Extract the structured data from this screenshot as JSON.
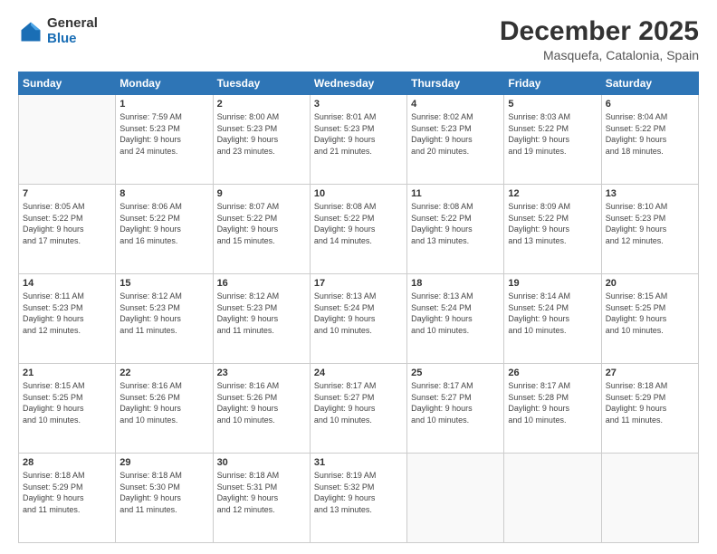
{
  "header": {
    "logo_general": "General",
    "logo_blue": "Blue",
    "month_title": "December 2025",
    "location": "Masquefa, Catalonia, Spain"
  },
  "days_of_week": [
    "Sunday",
    "Monday",
    "Tuesday",
    "Wednesday",
    "Thursday",
    "Friday",
    "Saturday"
  ],
  "weeks": [
    [
      {
        "num": "",
        "info": ""
      },
      {
        "num": "1",
        "info": "Sunrise: 7:59 AM\nSunset: 5:23 PM\nDaylight: 9 hours\nand 24 minutes."
      },
      {
        "num": "2",
        "info": "Sunrise: 8:00 AM\nSunset: 5:23 PM\nDaylight: 9 hours\nand 23 minutes."
      },
      {
        "num": "3",
        "info": "Sunrise: 8:01 AM\nSunset: 5:23 PM\nDaylight: 9 hours\nand 21 minutes."
      },
      {
        "num": "4",
        "info": "Sunrise: 8:02 AM\nSunset: 5:23 PM\nDaylight: 9 hours\nand 20 minutes."
      },
      {
        "num": "5",
        "info": "Sunrise: 8:03 AM\nSunset: 5:22 PM\nDaylight: 9 hours\nand 19 minutes."
      },
      {
        "num": "6",
        "info": "Sunrise: 8:04 AM\nSunset: 5:22 PM\nDaylight: 9 hours\nand 18 minutes."
      }
    ],
    [
      {
        "num": "7",
        "info": "Sunrise: 8:05 AM\nSunset: 5:22 PM\nDaylight: 9 hours\nand 17 minutes."
      },
      {
        "num": "8",
        "info": "Sunrise: 8:06 AM\nSunset: 5:22 PM\nDaylight: 9 hours\nand 16 minutes."
      },
      {
        "num": "9",
        "info": "Sunrise: 8:07 AM\nSunset: 5:22 PM\nDaylight: 9 hours\nand 15 minutes."
      },
      {
        "num": "10",
        "info": "Sunrise: 8:08 AM\nSunset: 5:22 PM\nDaylight: 9 hours\nand 14 minutes."
      },
      {
        "num": "11",
        "info": "Sunrise: 8:08 AM\nSunset: 5:22 PM\nDaylight: 9 hours\nand 13 minutes."
      },
      {
        "num": "12",
        "info": "Sunrise: 8:09 AM\nSunset: 5:22 PM\nDaylight: 9 hours\nand 13 minutes."
      },
      {
        "num": "13",
        "info": "Sunrise: 8:10 AM\nSunset: 5:23 PM\nDaylight: 9 hours\nand 12 minutes."
      }
    ],
    [
      {
        "num": "14",
        "info": "Sunrise: 8:11 AM\nSunset: 5:23 PM\nDaylight: 9 hours\nand 12 minutes."
      },
      {
        "num": "15",
        "info": "Sunrise: 8:12 AM\nSunset: 5:23 PM\nDaylight: 9 hours\nand 11 minutes."
      },
      {
        "num": "16",
        "info": "Sunrise: 8:12 AM\nSunset: 5:23 PM\nDaylight: 9 hours\nand 11 minutes."
      },
      {
        "num": "17",
        "info": "Sunrise: 8:13 AM\nSunset: 5:24 PM\nDaylight: 9 hours\nand 10 minutes."
      },
      {
        "num": "18",
        "info": "Sunrise: 8:13 AM\nSunset: 5:24 PM\nDaylight: 9 hours\nand 10 minutes."
      },
      {
        "num": "19",
        "info": "Sunrise: 8:14 AM\nSunset: 5:24 PM\nDaylight: 9 hours\nand 10 minutes."
      },
      {
        "num": "20",
        "info": "Sunrise: 8:15 AM\nSunset: 5:25 PM\nDaylight: 9 hours\nand 10 minutes."
      }
    ],
    [
      {
        "num": "21",
        "info": "Sunrise: 8:15 AM\nSunset: 5:25 PM\nDaylight: 9 hours\nand 10 minutes."
      },
      {
        "num": "22",
        "info": "Sunrise: 8:16 AM\nSunset: 5:26 PM\nDaylight: 9 hours\nand 10 minutes."
      },
      {
        "num": "23",
        "info": "Sunrise: 8:16 AM\nSunset: 5:26 PM\nDaylight: 9 hours\nand 10 minutes."
      },
      {
        "num": "24",
        "info": "Sunrise: 8:17 AM\nSunset: 5:27 PM\nDaylight: 9 hours\nand 10 minutes."
      },
      {
        "num": "25",
        "info": "Sunrise: 8:17 AM\nSunset: 5:27 PM\nDaylight: 9 hours\nand 10 minutes."
      },
      {
        "num": "26",
        "info": "Sunrise: 8:17 AM\nSunset: 5:28 PM\nDaylight: 9 hours\nand 10 minutes."
      },
      {
        "num": "27",
        "info": "Sunrise: 8:18 AM\nSunset: 5:29 PM\nDaylight: 9 hours\nand 11 minutes."
      }
    ],
    [
      {
        "num": "28",
        "info": "Sunrise: 8:18 AM\nSunset: 5:29 PM\nDaylight: 9 hours\nand 11 minutes."
      },
      {
        "num": "29",
        "info": "Sunrise: 8:18 AM\nSunset: 5:30 PM\nDaylight: 9 hours\nand 11 minutes."
      },
      {
        "num": "30",
        "info": "Sunrise: 8:18 AM\nSunset: 5:31 PM\nDaylight: 9 hours\nand 12 minutes."
      },
      {
        "num": "31",
        "info": "Sunrise: 8:19 AM\nSunset: 5:32 PM\nDaylight: 9 hours\nand 13 minutes."
      },
      {
        "num": "",
        "info": ""
      },
      {
        "num": "",
        "info": ""
      },
      {
        "num": "",
        "info": ""
      }
    ]
  ]
}
